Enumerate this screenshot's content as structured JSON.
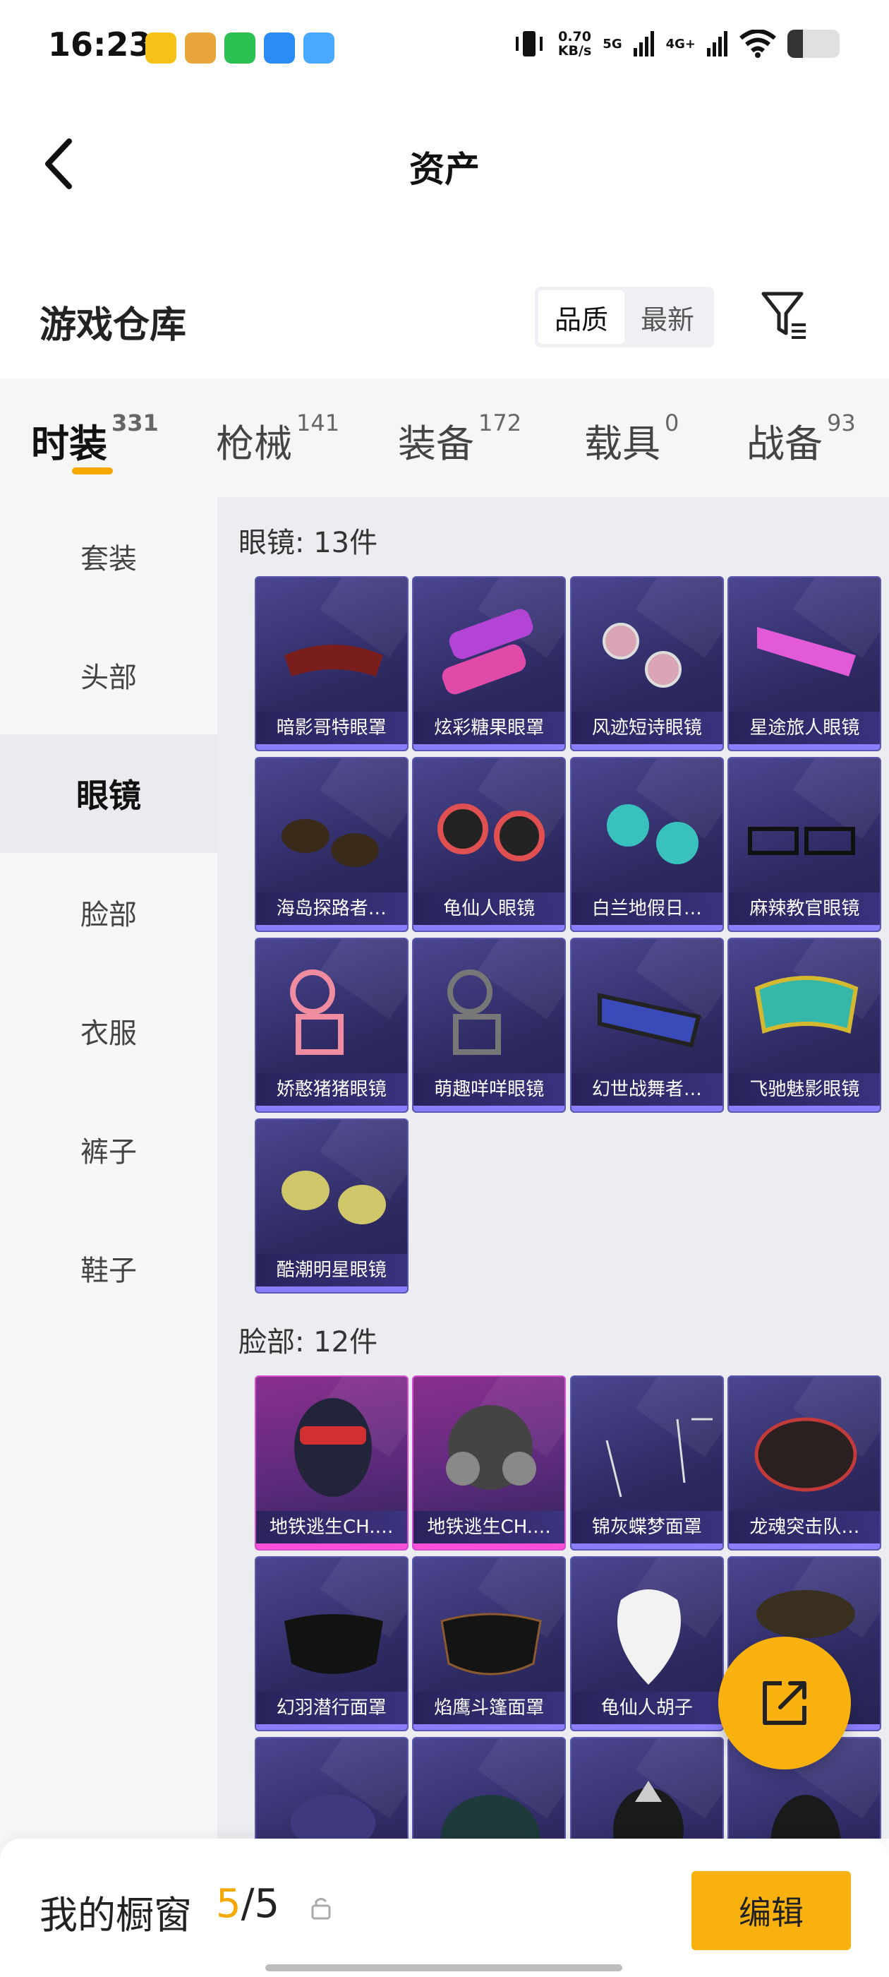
{
  "status_bar": {
    "time": "16:23",
    "speed_value": "0.70",
    "speed_unit": "KB/s",
    "net1": "5G",
    "net2": "4G+",
    "battery_level": 0.3
  },
  "header": {
    "title": "资产"
  },
  "warehouse": {
    "title": "游戏仓库",
    "sort_options": [
      "品质",
      "最新"
    ],
    "sort_active": "品质"
  },
  "tabs": [
    {
      "label": "时装",
      "count": "331"
    },
    {
      "label": "枪械",
      "count": "141"
    },
    {
      "label": "装备",
      "count": "172"
    },
    {
      "label": "载具",
      "count": "0"
    },
    {
      "label": "战备",
      "count": "93"
    }
  ],
  "sidebar": [
    "套装",
    "头部",
    "眼镜",
    "脸部",
    "衣服",
    "裤子",
    "鞋子"
  ],
  "sections": {
    "glasses": {
      "title": "眼镜: 13件",
      "items": [
        "暗影哥特眼罩",
        "炫彩糖果眼罩",
        "风迹短诗眼镜",
        "星途旅人眼镜",
        "海岛探路者…",
        "龟仙人眼镜",
        "白兰地假日…",
        "麻辣教官眼镜",
        "娇憨猪猪眼镜",
        "萌趣咩咩眼镜",
        "幻世战舞者…",
        "飞驰魅影眼镜",
        "酷潮明星眼镜"
      ]
    },
    "face": {
      "title": "脸部: 12件",
      "items": [
        "地铁逃生CH.…",
        "地铁逃生CH.…",
        "锦灰蝶梦面罩",
        "龙魂突击队…",
        "幻羽潜行面罩",
        "焰鹰斗篷面罩",
        "龟仙人胡子",
        "",
        "",
        "",
        "",
        ""
      ]
    }
  },
  "bottom": {
    "label": "我的橱窗",
    "count_current": "5",
    "count_total": "/5",
    "edit": "编辑"
  },
  "colors": {
    "accent": "#f8b10e",
    "card_blue": "#2e2a62",
    "card_pink": "#8a2f8e"
  }
}
